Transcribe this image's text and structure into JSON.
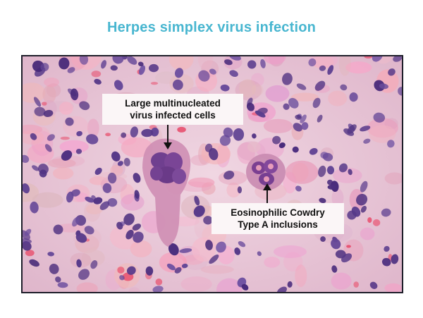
{
  "title": "Herpes simplex virus infection",
  "colors": {
    "title": "#48b6d0",
    "frame": "#1e1e2a",
    "tissue": "#e9c8d8",
    "nucleus": "#5a3a86",
    "rbc": "#e8506e",
    "label_bg": "#fbf6f7"
  },
  "callouts": [
    {
      "id": "large-multinucleated-cells",
      "lines": [
        "Large multinucleated",
        "virus infected cells"
      ]
    },
    {
      "id": "cowdry-type-a",
      "lines": [
        "Eosinophilic Cowdry",
        "Type A inclusions"
      ]
    }
  ]
}
